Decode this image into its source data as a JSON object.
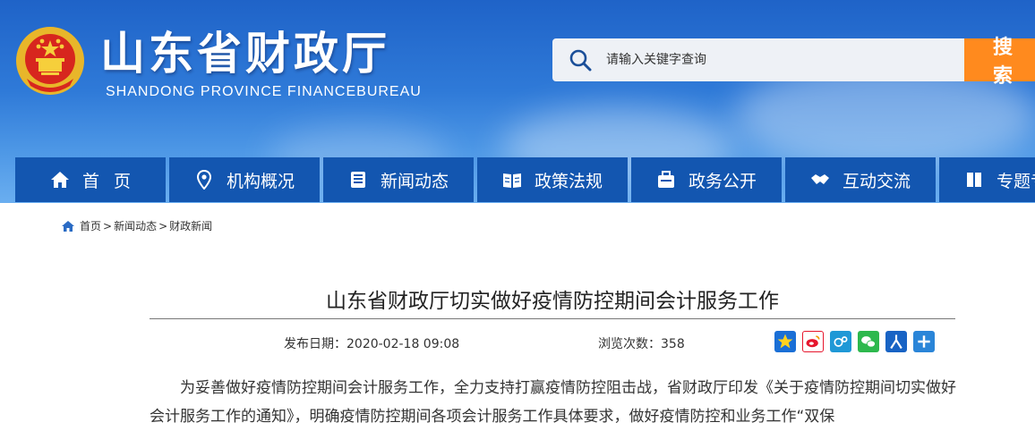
{
  "header": {
    "title_cn": "山东省财政厅",
    "title_en": "SHANDONG PROVINCE FINANCEBUREAU",
    "emblem_icon": "national-emblem-icon"
  },
  "search": {
    "placeholder": "请输入关键字查询",
    "button_label": "搜 索",
    "accent_color": "#ff8a1e"
  },
  "nav": {
    "bg_color": "#1356b0",
    "items": [
      {
        "label": "首页",
        "icon": "home-icon"
      },
      {
        "label": "机构概况",
        "icon": "location-pin-icon"
      },
      {
        "label": "新闻动态",
        "icon": "newspaper-icon"
      },
      {
        "label": "政策法规",
        "icon": "open-book-icon"
      },
      {
        "label": "政务公开",
        "icon": "briefcase-icon"
      },
      {
        "label": "互动交流",
        "icon": "handshake-icon"
      },
      {
        "label": "专题专栏",
        "icon": "book-icon"
      }
    ]
  },
  "breadcrumb": {
    "items": [
      "首页",
      "新闻动态",
      "财政新闻"
    ],
    "separator": ">"
  },
  "article": {
    "title": "山东省财政厅切实做好疫情防控期间会计服务工作",
    "date": "发布日期：2020-02-18 09:08",
    "views": "浏览次数：358",
    "body": "为妥善做好疫情防控期间会计服务工作，全力支持打赢疫情防控阻击战，省财政厅印发《关于疫情防控期间切实做好会计服务工作的通知》，明确疫情防控期间各项会计服务工作具体要求，做好疫情防控和业务工作“双保"
  },
  "share": [
    {
      "icon": "qzone-star-icon",
      "color": "#1a6fd6"
    },
    {
      "icon": "weibo-icon",
      "color": "#e6162d"
    },
    {
      "icon": "tencent-weibo-icon",
      "color": "#1f98d6"
    },
    {
      "icon": "wechat-icon",
      "color": "#2db84d"
    },
    {
      "icon": "renren-icon",
      "color": "#1863c4"
    },
    {
      "icon": "more-plus-icon",
      "color": "#2a85d8"
    }
  ]
}
